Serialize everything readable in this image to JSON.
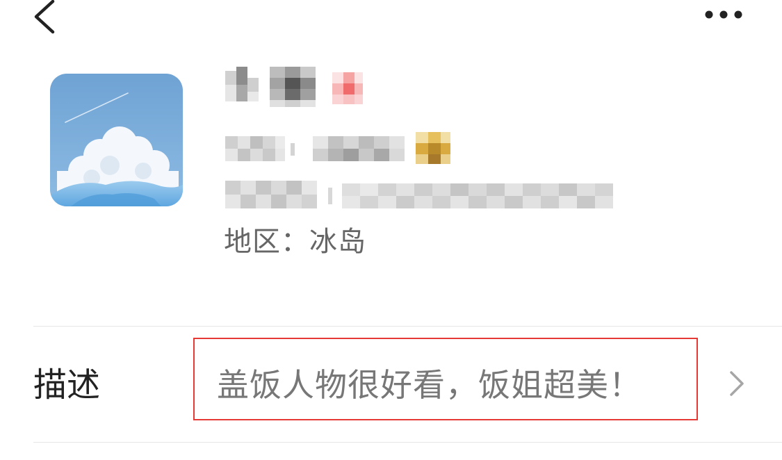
{
  "header": {
    "back_icon": "chevron-left-icon",
    "more_icon": "more-dots-icon"
  },
  "profile": {
    "nickname": "",
    "account_line": "",
    "id_line": "",
    "region_label": "地区：",
    "region_value": "冰岛"
  },
  "description": {
    "label": "描述",
    "value": "盖饭人物很好看，饭姐超美！",
    "highlight_color": "#e53935"
  }
}
